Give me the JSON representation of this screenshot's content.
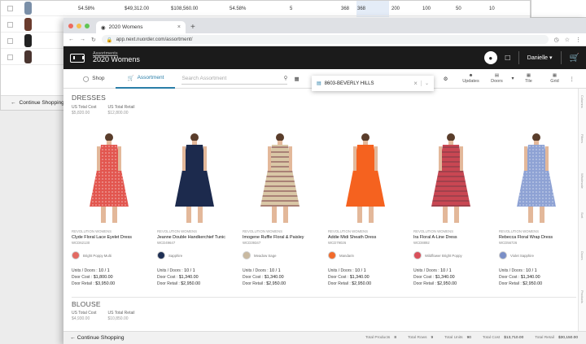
{
  "background_window": {
    "row": [
      "54.58%",
      "$49,312.00",
      "$108,560.00",
      "54.58%",
      "5",
      "368",
      "368",
      "200",
      "100",
      "50",
      "10"
    ],
    "thumb_colors": [
      "#7a8fa8",
      "#6b3c2e",
      "#222222",
      "#4a3530"
    ],
    "footer": "Continue Shopping"
  },
  "browser": {
    "tab_title": "2020 Womens",
    "url": "app.next.nuorder.com/assortment/",
    "dot_colors": [
      "#ed6a5e",
      "#f5bf4f",
      "#61c554"
    ]
  },
  "header": {
    "breadcrumb_link": "Assortments",
    "title": "2020 Womens",
    "user": "Danielle"
  },
  "toolbar": {
    "shop": "Shop",
    "assortment": "Assortment",
    "search_placeholder": "Search Assortment",
    "updates": "Updates",
    "doors": "Doors",
    "tile": "Tile",
    "grid": "Grid"
  },
  "door_dropdown": {
    "value": "8603-BEVERLY HILLS"
  },
  "dresses": {
    "title": "DRESSES",
    "us_total_cost_label": "US Total Cost",
    "us_total_cost": "$5,820.00",
    "us_total_retail_label": "US Total Retail",
    "us_total_retail": "$12,800.00"
  },
  "products": [
    {
      "brand": "REVOLUTION WOMENS",
      "name": "Clyde Floral Lace Eyelet Dress",
      "style": "WCD62130",
      "color": "Bright Poppy Multi",
      "swatch": "#e36a62",
      "units": "10 / 1",
      "cost": "$1,800.00",
      "retail": "$3,950.00",
      "dress": "#e2564f",
      "pattern": "dots"
    },
    {
      "brand": "REVOLUTION WOMENS",
      "name": "Jeanne Double Handkerchief Tunic",
      "style": "WCD49647",
      "color": "Sapphire",
      "swatch": "#1e2f54",
      "units": "10 / 1",
      "cost": "$1,340.00",
      "retail": "$2,950.00",
      "dress": "#1c2a4d",
      "pattern": "none"
    },
    {
      "brand": "REVOLUTION WOMENS",
      "name": "Imogene Ruffle Floral & Paisley",
      "style": "WCD39347",
      "color": "Meadow Sage",
      "swatch": "#c9b9a0",
      "units": "10 / 1",
      "cost": "$1,340.00",
      "retail": "$2,950.00",
      "dress": "#d9c7a6",
      "pattern": "stripes"
    },
    {
      "brand": "REVOLUTION WOMENS",
      "name": "Addie Midi Sheath Dress",
      "style": "WCD79026",
      "color": "Mandarin",
      "swatch": "#f26a2a",
      "units": "10 / 1",
      "cost": "$1,340.00",
      "retail": "$2,950.00",
      "dress": "#f5621f",
      "pattern": "none"
    },
    {
      "brand": "REVOLUTION WOMENS",
      "name": "Ira Floral A-Line Dress",
      "style": "WCD8892",
      "color": "Wildflower Bright Poppy",
      "swatch": "#d9505a",
      "units": "10 / 1",
      "cost": "$1,340.00",
      "retail": "$2,950.00",
      "dress": "#c94753",
      "pattern": "stripes"
    },
    {
      "brand": "REVOLUTION WOMENS",
      "name": "Rebecca Floral Wrap Dress",
      "style": "WCD56726",
      "color": "Violet Sapphire",
      "swatch": "#7a8fc7",
      "units": "10 / 1",
      "cost": "$1,340.00",
      "retail": "$2,950.00",
      "dress": "#8ea2d4",
      "pattern": "dots"
    }
  ],
  "product_labels": {
    "units_doors": "Units / Doors",
    "door_cost": "Door Cost",
    "door_retail": "Door Retail"
  },
  "blouse": {
    "title": "BLOUSE",
    "us_total_cost_label": "US Total Cost",
    "us_total_cost": "$4,930.00",
    "us_total_retail_label": "US Total Retail",
    "us_total_retail": "$10,850.00"
  },
  "footer": {
    "continue": "Continue Shopping",
    "total_products_label": "Total Products",
    "total_products": "8",
    "total_rows_label": "Total Rows",
    "total_rows": "9",
    "total_units_label": "Total Units",
    "total_units": "90",
    "total_cost_label": "Total Cost",
    "total_cost": "$13,710.00",
    "total_retail_label": "Total Retail",
    "total_retail": "$30,150.00"
  },
  "sidebar_labels": [
    "Columns",
    "Filters",
    "Wholesale",
    "Sort",
    "Doors",
    "Products"
  ]
}
